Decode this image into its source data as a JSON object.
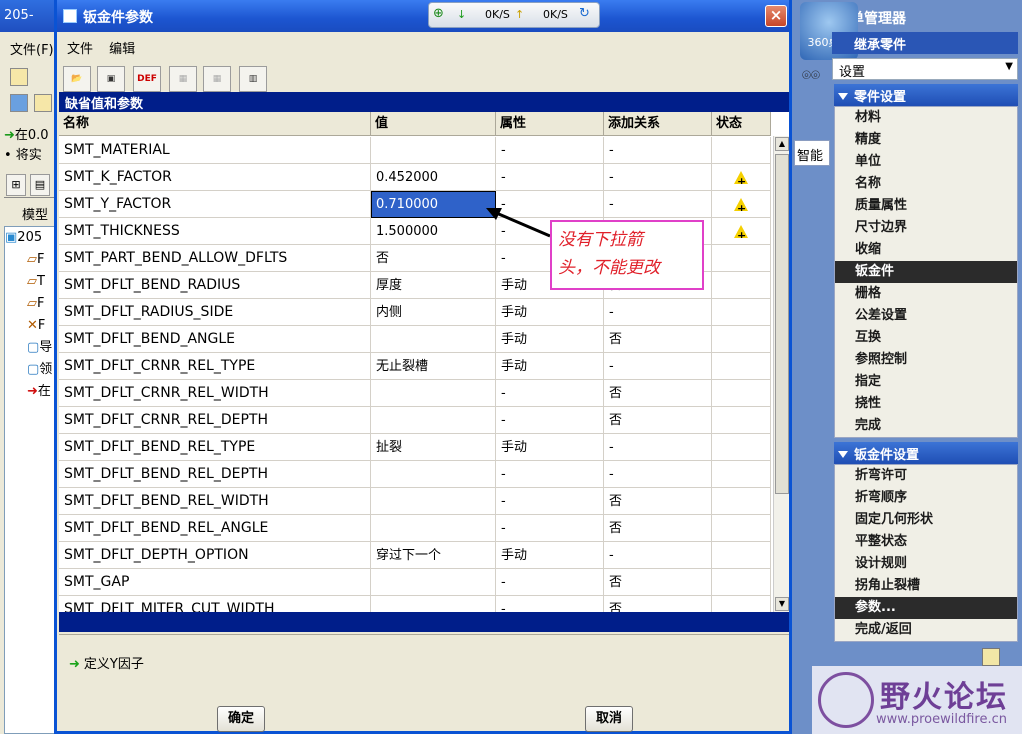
{
  "bg_app": {
    "title": "205-",
    "menu_file": "文件(F)",
    "msg1": "在0.0",
    "msg2": "• 将实",
    "model_label": "模型",
    "tree_root": "205",
    "tree_items": [
      "F",
      "T",
      "F",
      "F",
      "导",
      "领",
      "在"
    ]
  },
  "net_widget": {
    "down": "0K/S",
    "up": "0K/S"
  },
  "dialog": {
    "title": "钣金件参数",
    "close": "×",
    "menu": {
      "file": "文件",
      "edit": "编辑"
    },
    "toolbar": {
      "def": "DEF"
    },
    "section_title": "缺省值和参数",
    "columns": {
      "name": "名称",
      "value": "值",
      "attr": "属性",
      "relation": "添加关系",
      "status": "状态"
    },
    "rows": [
      {
        "name": "SMT_MATERIAL",
        "value": "",
        "attr": "-",
        "rel": "-",
        "warn": false
      },
      {
        "name": "SMT_K_FACTOR",
        "value": "0.452000",
        "attr": "-",
        "rel": "-",
        "warn": true
      },
      {
        "name": "SMT_Y_FACTOR",
        "value": "0.710000",
        "attr": "-",
        "rel": "-",
        "warn": true,
        "selected": true
      },
      {
        "name": "SMT_THICKNESS",
        "value": "1.500000",
        "attr": "-",
        "rel": "",
        "warn": true
      },
      {
        "name": "SMT_PART_BEND_ALLOW_DFLTS",
        "value": "否",
        "attr": "-",
        "rel": "",
        "warn": false
      },
      {
        "name": "SMT_DFLT_BEND_RADIUS",
        "value": "厚度",
        "attr": "手动",
        "rel": "否",
        "warn": false
      },
      {
        "name": "SMT_DFLT_RADIUS_SIDE",
        "value": "内侧",
        "attr": "手动",
        "rel": "-",
        "warn": false
      },
      {
        "name": "SMT_DFLT_BEND_ANGLE",
        "value": "",
        "attr": "手动",
        "rel": "否",
        "warn": false
      },
      {
        "name": "SMT_DFLT_CRNR_REL_TYPE",
        "value": "无止裂槽",
        "attr": "手动",
        "rel": "-",
        "warn": false
      },
      {
        "name": "SMT_DFLT_CRNR_REL_WIDTH",
        "value": "",
        "attr": "-",
        "rel": "否",
        "warn": false
      },
      {
        "name": "SMT_DFLT_CRNR_REL_DEPTH",
        "value": "",
        "attr": "-",
        "rel": "否",
        "warn": false
      },
      {
        "name": "SMT_DFLT_BEND_REL_TYPE",
        "value": "扯裂",
        "attr": "手动",
        "rel": "-",
        "warn": false
      },
      {
        "name": "SMT_DFLT_BEND_REL_DEPTH",
        "value": "",
        "attr": "-",
        "rel": "-",
        "warn": false
      },
      {
        "name": "SMT_DFLT_BEND_REL_WIDTH",
        "value": "",
        "attr": "-",
        "rel": "否",
        "warn": false
      },
      {
        "name": "SMT_DFLT_BEND_REL_ANGLE",
        "value": "",
        "attr": "-",
        "rel": "否",
        "warn": false
      },
      {
        "name": "SMT_DFLT_DEPTH_OPTION",
        "value": "穿过下一个",
        "attr": "手动",
        "rel": "-",
        "warn": false
      },
      {
        "name": "SMT_GAP",
        "value": "",
        "attr": "-",
        "rel": "否",
        "warn": false
      },
      {
        "name": "SMT_DFLT_MITER_CUT_WIDTH",
        "value": "",
        "attr": "-",
        "rel": "否",
        "warn": false
      }
    ],
    "status_text": "定义Y因子",
    "ok": "确定",
    "cancel": "取消"
  },
  "callout": {
    "line1": "没有下拉箭",
    "line2": "头，不能更改"
  },
  "right_panel": {
    "title": "单管理器",
    "desktop_badge": "360桌面",
    "inherit": "继承零件",
    "settings": "设置",
    "smart": "智能",
    "part_settings_title": "零件设置",
    "part_items": [
      "材料",
      "精度",
      "单位",
      "名称",
      "质量属性",
      "尺寸边界",
      "收缩",
      "钣金件",
      "栅格",
      "公差设置",
      "互换",
      "参照控制",
      "指定",
      "挠性",
      "完成"
    ],
    "part_selected_index": 7,
    "sheet_settings_title": "钣金件设置",
    "sheet_items": [
      "折弯许可",
      "折弯顺序",
      "固定几何形状",
      "平整状态",
      "设计规则",
      "拐角止裂槽",
      "参数...",
      "完成/返回"
    ],
    "sheet_selected_index": 6,
    "watermark_name": "野火论坛",
    "watermark_url": "www.proewildfire.cn"
  }
}
